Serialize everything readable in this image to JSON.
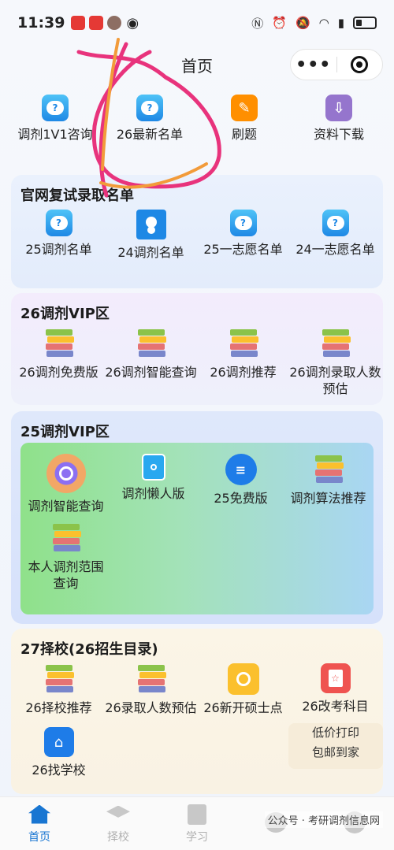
{
  "status_bar": {
    "time": "11:39",
    "battery": "battery-icon"
  },
  "nav": {
    "title": "首页",
    "more": "•••"
  },
  "top_shortcuts": [
    {
      "label": "调剂1V1咨询",
      "icon": "chat-bubble-icon"
    },
    {
      "label": "26最新名单",
      "icon": "chat-bubble-icon"
    },
    {
      "label": "刷题",
      "icon": "edit-icon"
    },
    {
      "label": "资料下载",
      "icon": "download-icon"
    }
  ],
  "section_official": {
    "title": "官网复试录取名单",
    "items": [
      {
        "label": "25调剂名单",
        "icon": "chat-bubble-icon"
      },
      {
        "label": "24调剂名单",
        "icon": "person-icon"
      },
      {
        "label": "25一志愿名单",
        "icon": "chat-bubble-icon"
      },
      {
        "label": "24一志愿名单",
        "icon": "chat-bubble-icon"
      }
    ]
  },
  "section_26vip": {
    "title": "26调剂VIP区",
    "items": [
      {
        "label": "26调剂免费版",
        "icon": "books-icon"
      },
      {
        "label": "26调剂智能查询",
        "icon": "books-icon"
      },
      {
        "label": "26调剂推荐",
        "icon": "books-icon"
      },
      {
        "label": "26调剂录取人数预估",
        "icon": "books-icon"
      }
    ]
  },
  "section_25vip": {
    "title": "25调剂VIP区",
    "items": [
      {
        "label": "调剂智能查询",
        "icon": "magnify-icon"
      },
      {
        "label": "调剂懒人版",
        "icon": "person-card-icon"
      },
      {
        "label": "25免费版",
        "icon": "document-icon"
      },
      {
        "label": "调剂算法推荐",
        "icon": "books-icon"
      },
      {
        "label": "本人调剂范围查询",
        "icon": "books-icon"
      }
    ]
  },
  "section_27": {
    "title": "27择校(26招生目录)",
    "items": [
      {
        "label": "26择校推荐",
        "icon": "books-icon"
      },
      {
        "label": "26录取人数预估",
        "icon": "books-icon"
      },
      {
        "label": "26新开硕士点",
        "icon": "badge-icon"
      },
      {
        "label": "26改考科目",
        "icon": "red-book-icon"
      },
      {
        "label": "26找学校",
        "icon": "school-icon"
      }
    ],
    "promo_line1": "低价打印",
    "promo_line2": "包邮到家"
  },
  "tab_bar": [
    {
      "label": "首页",
      "active": true
    },
    {
      "label": "择校",
      "active": false
    },
    {
      "label": "学习",
      "active": false
    },
    {
      "label": "",
      "active": false
    },
    {
      "label": "",
      "active": false
    }
  ],
  "watermark": "公众号 · 考研调剂信息网",
  "colors": {
    "accent": "#1976d2",
    "annotation": "#e8337c",
    "annotation2": "#f29b3a"
  }
}
